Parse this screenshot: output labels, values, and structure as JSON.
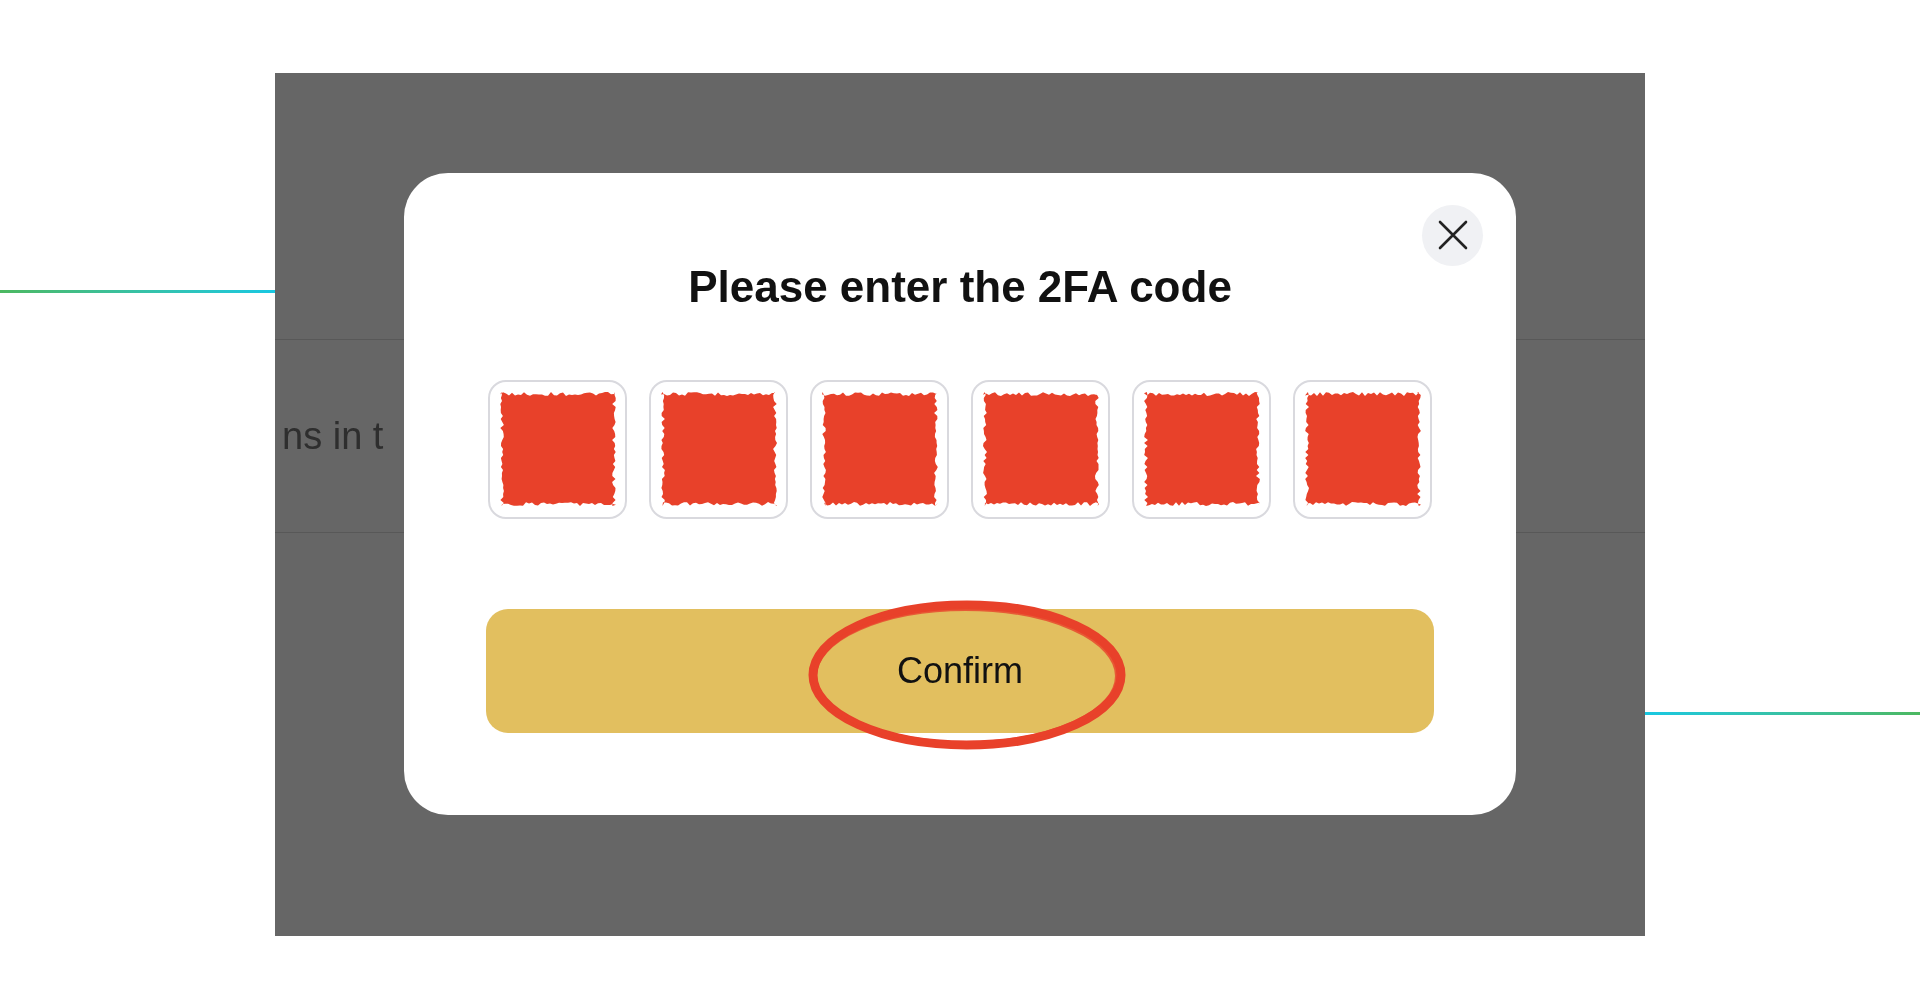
{
  "background_page": {
    "text_fragment": "ns in t"
  },
  "dialog": {
    "title": "Please enter the 2FA code",
    "code_digits": [
      {
        "redacted": true
      },
      {
        "redacted": true
      },
      {
        "redacted": true
      },
      {
        "redacted": true
      },
      {
        "redacted": true
      },
      {
        "redacted": true
      }
    ],
    "confirm_button": {
      "label": "Confirm",
      "circled": true
    }
  }
}
